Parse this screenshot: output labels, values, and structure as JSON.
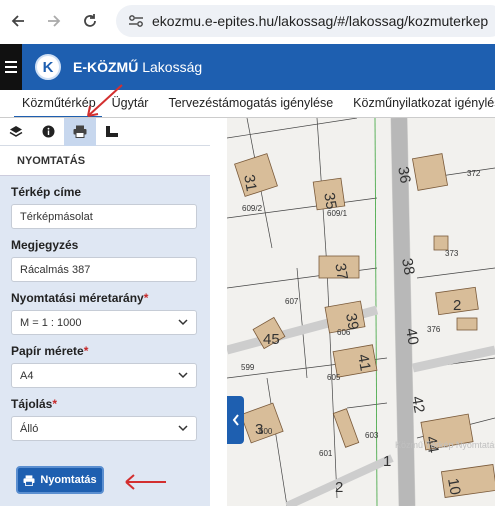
{
  "browser": {
    "url": "ekozmu.e-epites.hu/lakossag/#/lakossag/kozmuterkep"
  },
  "app": {
    "logo_letter": "K",
    "name": "E-KÖZMŰ",
    "section": "Lakosság"
  },
  "top_tabs": [
    {
      "label": "Közműtérkép"
    },
    {
      "label": "Ügytár"
    },
    {
      "label": "Tervezéstámogatás igénylése"
    },
    {
      "label": "Közműnyilatkozat igénylése"
    }
  ],
  "panel": {
    "title": "NYOMTATÁS",
    "map_title_label": "Térkép címe",
    "map_title_value": "Térképmásolat",
    "note_label": "Megjegyzés",
    "note_value": "Rácalmás 387",
    "scale_label": "Nyomtatási méretarány",
    "scale_value": "M = 1 : 1000",
    "paper_label": "Papír mérete",
    "paper_value": "A4",
    "orientation_label": "Tájolás",
    "orientation_value": "Álló",
    "required_mark": "*",
    "print_button": "Nyomtatás"
  },
  "map": {
    "parcel_numbers": [
      "31",
      "609/2",
      "35",
      "609/1",
      "36",
      "372",
      "373",
      "37",
      "38",
      "607",
      "2",
      "376",
      "39",
      "606",
      "45",
      "599",
      "41",
      "605",
      "40",
      "42",
      "3",
      "600",
      "601",
      "603",
      "1",
      "44",
      "10",
      "2"
    ],
    "watermark": "Közmű Térkép Nyomtatás"
  },
  "colors": {
    "brand_blue": "#1e5fb0",
    "building": "#d8bd99",
    "road": "#c8c8c8",
    "annotation_red": "#d32f2f"
  }
}
